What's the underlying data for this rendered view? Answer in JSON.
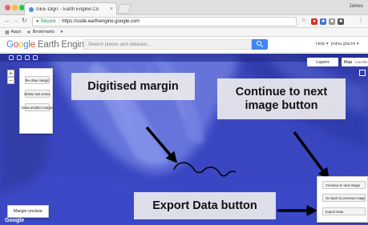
{
  "browser": {
    "tab_title": "GEE-DigiT - Earth Engine Co",
    "tab_close": "×",
    "user_name": "James",
    "secure_label": "Secure",
    "url": "https://code.earthengine.google.com",
    "bookmarks": [
      {
        "label": "Apps",
        "icon": "apps-grid-icon"
      },
      {
        "label": "Bookmarks",
        "icon": "star-icon"
      }
    ]
  },
  "header": {
    "logo_letters": [
      "G",
      "o",
      "o",
      "g",
      "l",
      "e"
    ],
    "logo_suffix": " Earth Engine",
    "search_placeholder": "Search places and datasets...",
    "help_label": "Help ▾",
    "user_label": "jtobia.glaciol ▾"
  },
  "map": {
    "zoom_in": "+",
    "zoom_out": "−",
    "layers_label": "Layers",
    "map_type_label": "Map",
    "satellite_label": "Satellite",
    "left_panel": {
      "buttons": [
        "Re-draw margin",
        "Delete last vertex",
        "Draw another margin"
      ]
    },
    "right_panel": {
      "buttons": [
        "Continue to next image",
        "Go back to previous image",
        "Export Data"
      ]
    },
    "margin_unclear_label": "Margin unclear",
    "google_label": "Google"
  },
  "annotations": {
    "digitised_margin": "Digitised margin",
    "continue_button": "Continue to next image button",
    "export_button": "Export Data button"
  },
  "colors": {
    "map_blue": "#3a46bf",
    "search_button": "#4285f4",
    "annotation_bg": "#e8e8ec",
    "margin_line": "#000000"
  }
}
